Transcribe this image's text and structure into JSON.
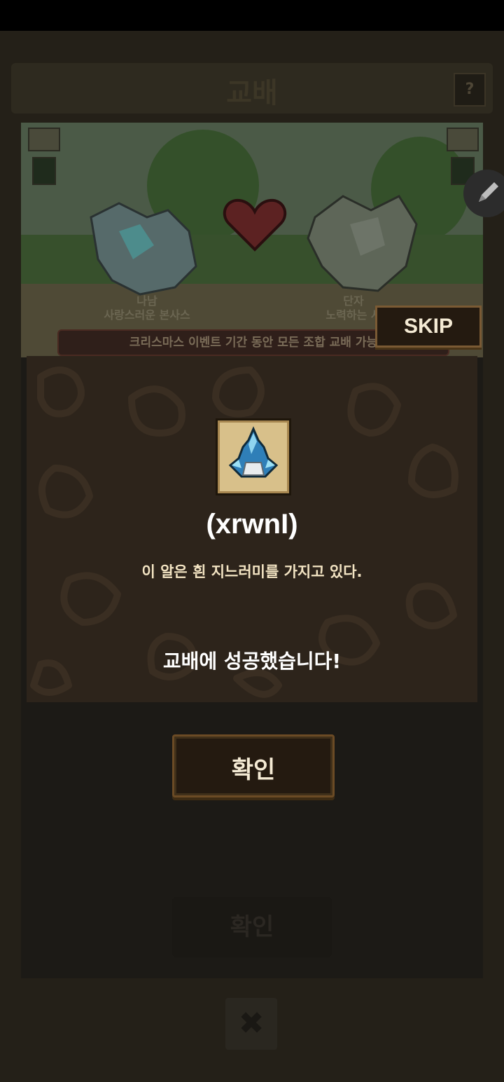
{
  "screen": {
    "title": "교배",
    "help_label": "?",
    "left_parent_label": "나남\n사랑스러운 본사스",
    "right_parent_label": "단자\n노력하는 사",
    "event_notice": "크리스마스 이벤트 기간 동안 모든 조합 교배 가능",
    "background_confirm_label": "확인",
    "close_label": "✖"
  },
  "skip_button": {
    "label": "SKIP"
  },
  "result": {
    "item_name": "(xrwnI)",
    "item_description": "이 알은 흰 지느러미를 가지고 있다.",
    "success_message": "교배에 성공했습니다!",
    "confirm_label": "확인",
    "item_icon": "blue-egg-icon"
  },
  "colors": {
    "panel_bg": "#2d241b",
    "frame_gold": "#d8c08a",
    "button_border": "#6b4b25",
    "text_cream": "#f3e4c3"
  }
}
